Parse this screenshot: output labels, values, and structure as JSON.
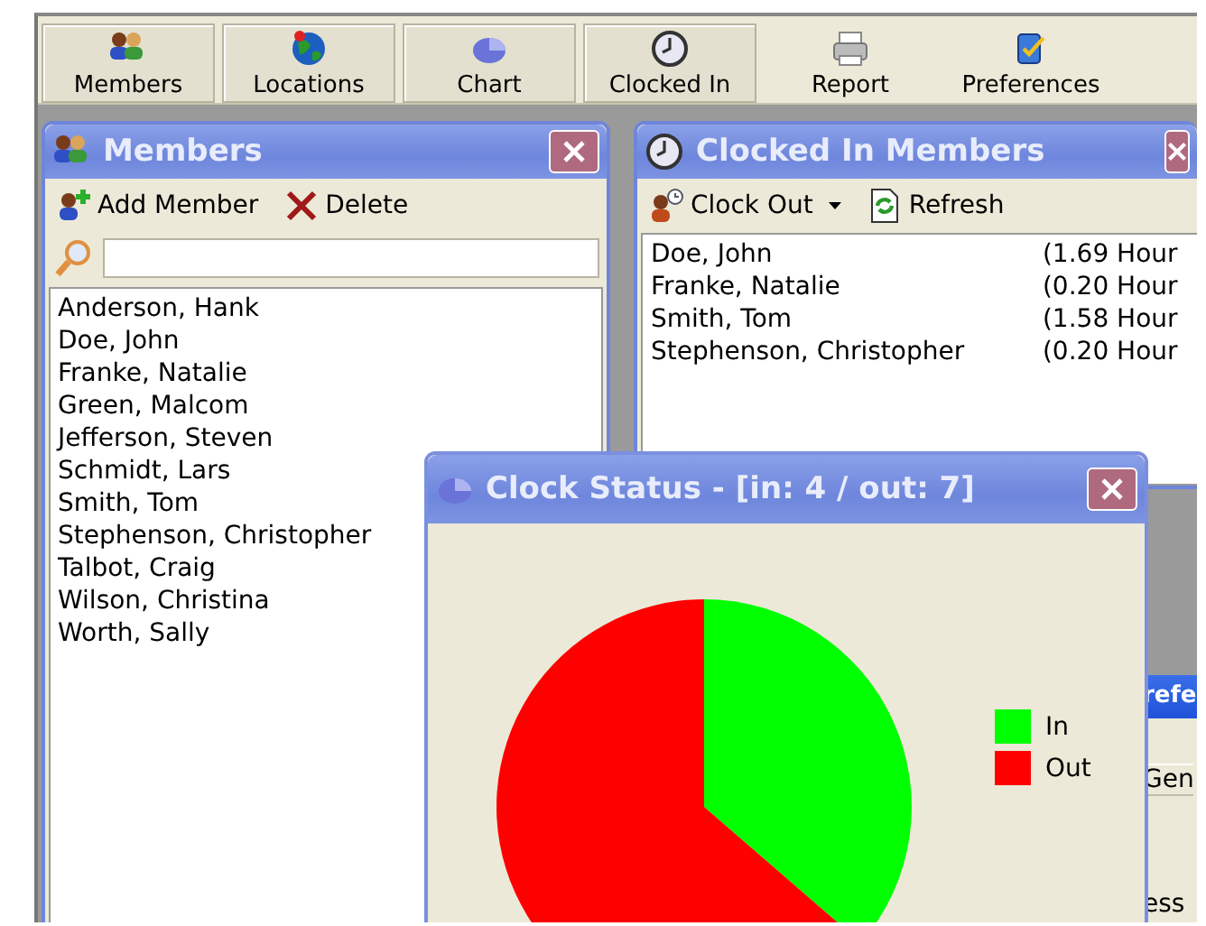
{
  "toolbar": [
    {
      "label": "Members",
      "selected": true
    },
    {
      "label": "Locations",
      "selected": true
    },
    {
      "label": "Chart",
      "selected": true
    },
    {
      "label": "Clocked In",
      "selected": true
    },
    {
      "label": "Report",
      "selected": false
    },
    {
      "label": "Preferences",
      "selected": false
    }
  ],
  "members_panel": {
    "title": "Members",
    "actions": [
      {
        "label": "Add Member",
        "kind": "add"
      },
      {
        "label": "Delete",
        "kind": "delete"
      }
    ],
    "items": [
      "Anderson, Hank",
      "Doe, John",
      "Franke, Natalie",
      "Green, Malcom",
      "Jefferson, Steven",
      "Schmidt, Lars",
      "Smith, Tom",
      "Stephenson, Christopher",
      "Talbot, Craig",
      "Wilson, Christina",
      "Worth, Sally"
    ]
  },
  "clocked_in_panel": {
    "title": "Clocked In Members",
    "actions": [
      {
        "label": "Clock Out",
        "kind": "dropdown"
      },
      {
        "label": "Refresh",
        "kind": "refresh"
      }
    ],
    "rows": [
      {
        "name": "Doe, John",
        "hours": "(1.69 Hour"
      },
      {
        "name": "Franke, Natalie",
        "hours": "(0.20 Hour"
      },
      {
        "name": "Smith, Tom",
        "hours": "(1.58 Hour"
      },
      {
        "name": "Stephenson, Christopher",
        "hours": "(0.20 Hour"
      }
    ]
  },
  "preferences_window": {
    "title": "refe",
    "tab": "Gen",
    "text": "ess"
  },
  "clock_status_window": {
    "title": "Clock Status - [in: 4 / out: 7]",
    "chart_data": {
      "type": "pie",
      "legend": "right",
      "categories": [
        "In",
        "Out"
      ],
      "values": [
        36.36,
        63.64
      ],
      "colors": [
        "#00ff00",
        "#ff0000"
      ]
    }
  }
}
